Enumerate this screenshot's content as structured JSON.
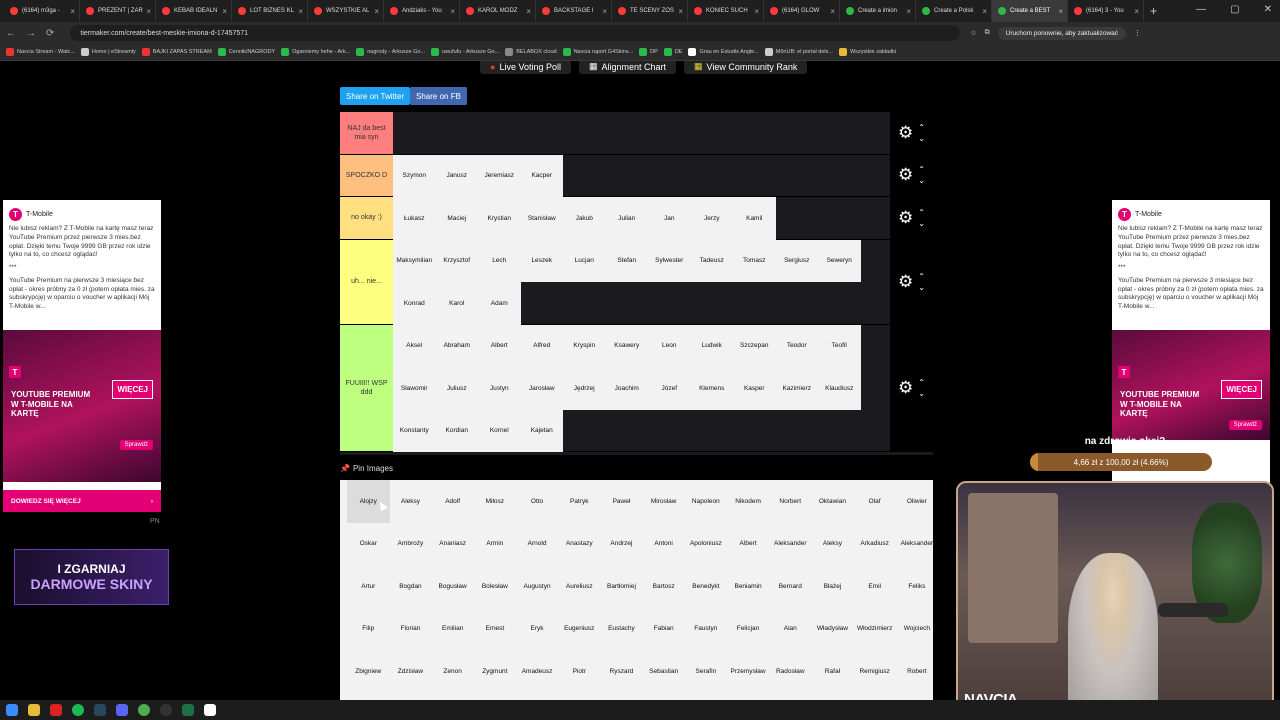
{
  "browser": {
    "tabs": [
      {
        "label": "(6164) m3ga -",
        "icon": "yt"
      },
      {
        "label": "PREZENT | ZAR",
        "icon": "yt"
      },
      {
        "label": "KEBAB IDEALN",
        "icon": "yt"
      },
      {
        "label": "LOT BIZNES KL",
        "icon": "yt"
      },
      {
        "label": "WSZYSTKIE AL",
        "icon": "yt"
      },
      {
        "label": "Andziaks - You",
        "icon": "yt"
      },
      {
        "label": "KAROL MODZ",
        "icon": "yt"
      },
      {
        "label": "BACKSTAGE I",
        "icon": "yt"
      },
      {
        "label": "TE SCENY ZOS",
        "icon": "yt"
      },
      {
        "label": "KONIEC SUCH",
        "icon": "yt"
      },
      {
        "label": "(6164) GLOW",
        "icon": "yt"
      },
      {
        "label": "Create a imion",
        "icon": "tm"
      },
      {
        "label": "Create a Polsk",
        "icon": "tm"
      },
      {
        "label": "Create a BEST",
        "icon": "tm"
      },
      {
        "label": "(6164) 3 - You",
        "icon": "yt"
      }
    ],
    "url": "tiermaker.com/create/best-meskie-imiona-d-17457571",
    "update_button": "Uruchom ponownie, aby zaktualizować",
    "bookmarks": [
      "Navcia Stream - Watc...",
      "Home | eStreamly",
      "BAJKI ZAPAS STREAM",
      "Cennik/NAGRODY",
      "Ogarniemy hehe - Ark...",
      "nagrody - Arkusze Go...",
      "uwufufu - Arkusze Go...",
      "BELABOX cloud",
      "Navcia raport G4Skins...",
      "DP",
      "DE",
      "Grau en Estudis Angle...",
      "MõnUB: el portal dels...",
      "Wszystkie zakładki"
    ]
  },
  "toolbar": {
    "live_poll": "Live Voting Poll",
    "alignment": "Alignment Chart",
    "community": "View Community Rank",
    "share_twitter": "Share on Twitter",
    "share_fb": "Share on FB"
  },
  "tiers": [
    {
      "label": "NAJ da best mia syn",
      "color": "#ff7f7f",
      "items": []
    },
    {
      "label": "SPOCZKO D",
      "color": "#ffbf7f",
      "items": [
        "Szymon",
        "Janusz",
        "Jeremiasz",
        "Kacper"
      ]
    },
    {
      "label": "no okay :)",
      "color": "#ffdf7f",
      "items": [
        "Łukasz",
        "Maciej",
        "Krystian",
        "Stanisław",
        "Jakub",
        "Julian",
        "Jan",
        "Jerzy",
        "Kamil"
      ]
    },
    {
      "label": "uh... nie...",
      "color": "#ffff7f",
      "items": [
        "Maksymilian",
        "Krzysztof",
        "Lech",
        "Leszek",
        "Lucjan",
        "Stefan",
        "Sylwester",
        "Tadeusz",
        "Tomasz",
        "Sergiusz",
        "Seweryn",
        "Konrad",
        "Karol",
        "Adam"
      ]
    },
    {
      "label": "FUUIII!! WSP ddd",
      "color": "#bfff7f",
      "items": [
        "Aksel",
        "Abraham",
        "Albert",
        "Alfred",
        "Kryspin",
        "Ksawery",
        "Leon",
        "Ludwik",
        "Szczepan",
        "Teodor",
        "Teofil",
        "Sławomir",
        "Juliusz",
        "Justyn",
        "Jarosław",
        "Jędrzej",
        "Joachim",
        "Józef",
        "Klemens",
        "Kasper",
        "Kazimierz",
        "Klaudiusz",
        "Konstanty",
        "Kordian",
        "Kornel",
        "Kajetan"
      ]
    }
  ],
  "pin_label": "Pin Images",
  "pool": [
    "Alojzy",
    "Aleksy",
    "Adolf",
    "Miłosz",
    "Otto",
    "Patryk",
    "Paweł",
    "Mirosław",
    "Napoleon",
    "Nikodem",
    "Norbert",
    "Oktawian",
    "Olaf",
    "Oliwier",
    "Oskar",
    "Ambroży",
    "Ananiasz",
    "Armin",
    "Arnold",
    "Anastazy",
    "Andrzej",
    "Antoni",
    "Apoloniusz",
    "Albert",
    "Aleksander",
    "Aleksy",
    "Arkadiusz",
    "Aleksander",
    "Artur",
    "Bogdan",
    "Bogusław",
    "Bolesław",
    "Augustyn",
    "Aureliusz",
    "Bartłomiej",
    "Bartosz",
    "Benedykt",
    "Beniamin",
    "Bernard",
    "Błażej",
    "Emil",
    "Feliks",
    "Filip",
    "Florian",
    "Emilian",
    "Ernest",
    "Eryk",
    "Eugeniusz",
    "Eustachy",
    "Fabian",
    "Faustyn",
    "Felicjan",
    "Alan",
    "Władysław",
    "Włodzimierz",
    "Wojciech",
    "Zbigniew",
    "Zdzisław",
    "Zenon",
    "Zygmunt",
    "Amadeusz",
    "Piotr",
    "Ryszard",
    "Sebastian",
    "Serafin",
    "Przemysław",
    "Radosław",
    "Rafał",
    "Remigiusz",
    "Robert"
  ],
  "ad": {
    "brand": "T-Mobile",
    "text1": "Nie lubisz reklam? Z T-Mobile na kartę masz teraz YouTube Premium przez pierwsze 3 mies.bez opłat. Dzięki temu Twoje 9999 GB przez rok idzie tylko na to, co chcesz oglądać!",
    "sep": "***",
    "text2": "YouTube Premium na pierwsze 3 miesiące bez opłat - okres próbny za 0 zł (potem opłata mies. za subskrypcję) w oparciu o voucher w aplikacji Mój T-Mobile w...",
    "promo": "YOUTUBE PREMIUM W T-MOBILE NA KARTĘ",
    "badge": "WIĘCEJ",
    "sprawdz": "Sprawdź",
    "cta": "DOWIEDZ SIĘ WIĘCEJ"
  },
  "pn": "PN",
  "skins": {
    "l1": "I ZGARNIAJ",
    "l2": "DARMOWE SKINY"
  },
  "overlay": {
    "question": "na zdrowie okej?",
    "goal_text": "4,66 zł z 100,00 zł (4.66%)",
    "goal_progress": 0.0466,
    "cam_name": "NAVCIA"
  }
}
